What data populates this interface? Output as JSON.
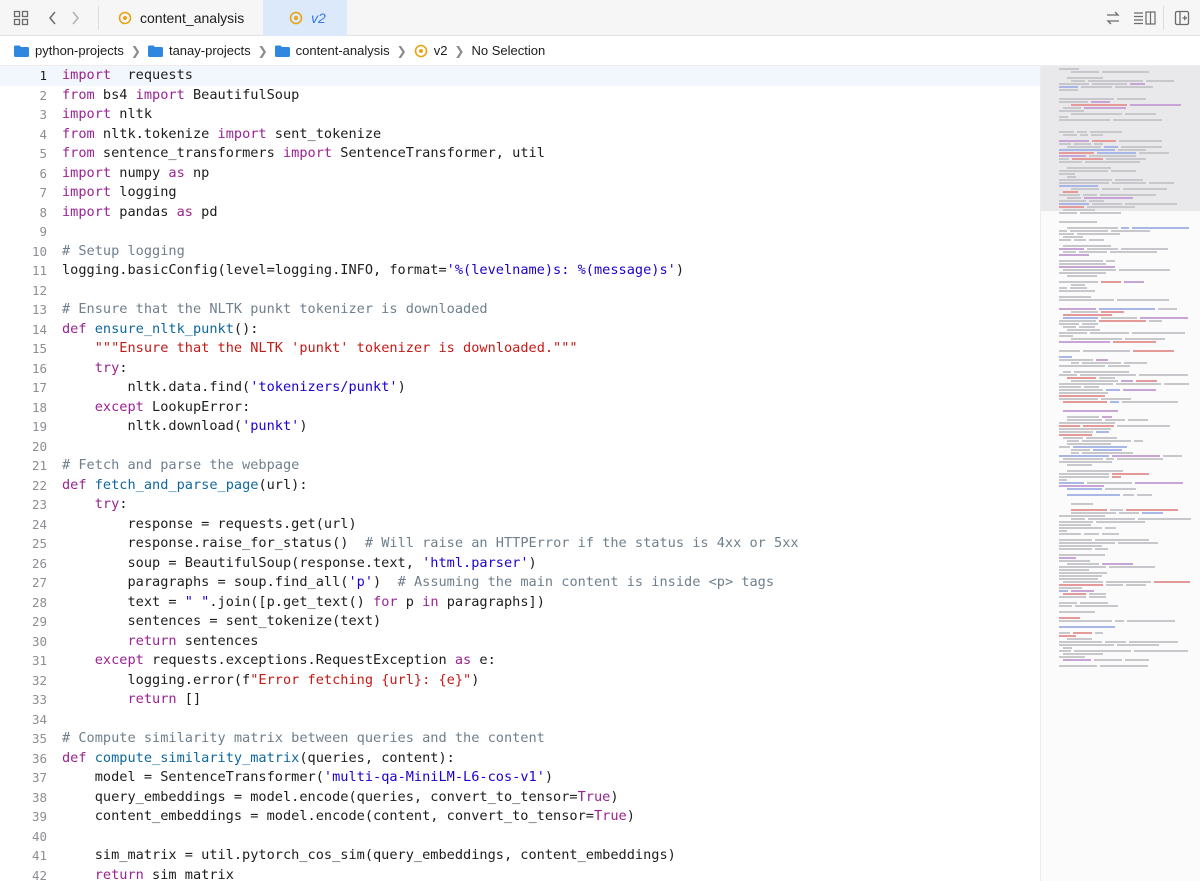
{
  "tabs": [
    {
      "label": "content_analysis",
      "active": false
    },
    {
      "label": "v2",
      "active": true
    }
  ],
  "breadcrumb": [
    {
      "label": "python-projects",
      "icon": "folder-icon"
    },
    {
      "label": "tanay-projects",
      "icon": "folder-icon"
    },
    {
      "label": "content-analysis",
      "icon": "folder-icon"
    },
    {
      "label": "v2",
      "icon": "python-file-icon"
    },
    {
      "label": "No Selection",
      "icon": ""
    }
  ],
  "editor": {
    "current_line": 1,
    "lines": [
      {
        "n": "1",
        "t": [
          [
            "k",
            "import"
          ],
          [
            "",
            "  requests"
          ]
        ]
      },
      {
        "n": "2",
        "t": [
          [
            "k",
            "from"
          ],
          [
            "",
            " bs4 "
          ],
          [
            "k",
            "import"
          ],
          [
            "",
            " BeautifulSoup"
          ]
        ]
      },
      {
        "n": "3",
        "t": [
          [
            "k",
            "import"
          ],
          [
            "",
            " nltk"
          ]
        ]
      },
      {
        "n": "4",
        "t": [
          [
            "k",
            "from"
          ],
          [
            "",
            " nltk.tokenize "
          ],
          [
            "k",
            "import"
          ],
          [
            "",
            " sent_tokenize"
          ]
        ]
      },
      {
        "n": "5",
        "t": [
          [
            "k",
            "from"
          ],
          [
            "",
            " sentence_transformers "
          ],
          [
            "k",
            "import"
          ],
          [
            "",
            " SentenceTransformer, util"
          ]
        ]
      },
      {
        "n": "6",
        "t": [
          [
            "k",
            "import"
          ],
          [
            "",
            " numpy "
          ],
          [
            "k",
            "as"
          ],
          [
            "",
            " np"
          ]
        ]
      },
      {
        "n": "7",
        "t": [
          [
            "k",
            "import"
          ],
          [
            "",
            " logging"
          ]
        ]
      },
      {
        "n": "8",
        "t": [
          [
            "k",
            "import"
          ],
          [
            "",
            " pandas "
          ],
          [
            "k",
            "as"
          ],
          [
            "",
            " pd"
          ]
        ]
      },
      {
        "n": "9",
        "t": []
      },
      {
        "n": "10",
        "t": [
          [
            "c",
            "# Setup logging"
          ]
        ]
      },
      {
        "n": "11",
        "t": [
          [
            "",
            "logging.basicConfig(level=logging.INFO, format="
          ],
          [
            "s",
            "'%(levelname)s: %(message)s'"
          ],
          [
            "",
            ")"
          ]
        ]
      },
      {
        "n": "12",
        "t": []
      },
      {
        "n": "13",
        "t": [
          [
            "c",
            "# Ensure that the NLTK punkt tokenizer is downloaded"
          ]
        ]
      },
      {
        "n": "14",
        "t": [
          [
            "k",
            "def"
          ],
          [
            "",
            " "
          ],
          [
            "f",
            "ensure_nltk_punkt"
          ],
          [
            "",
            "():"
          ]
        ]
      },
      {
        "n": "15",
        "t": [
          [
            "",
            "    "
          ],
          [
            "ds",
            "\"\"\"Ensure that the NLTK 'punkt' tokenizer is downloaded.\"\"\""
          ]
        ]
      },
      {
        "n": "16",
        "t": [
          [
            "",
            "    "
          ],
          [
            "k",
            "try"
          ],
          [
            "",
            ":"
          ]
        ]
      },
      {
        "n": "17",
        "t": [
          [
            "",
            "        nltk.data.find("
          ],
          [
            "s",
            "'tokenizers/punkt'"
          ],
          [
            "",
            ")"
          ]
        ]
      },
      {
        "n": "18",
        "t": [
          [
            "",
            "    "
          ],
          [
            "k",
            "except"
          ],
          [
            "",
            " LookupError:"
          ]
        ]
      },
      {
        "n": "19",
        "t": [
          [
            "",
            "        nltk.download("
          ],
          [
            "s",
            "'punkt'"
          ],
          [
            "",
            ")"
          ]
        ]
      },
      {
        "n": "20",
        "t": []
      },
      {
        "n": "21",
        "t": [
          [
            "c",
            "# Fetch and parse the webpage"
          ]
        ]
      },
      {
        "n": "22",
        "t": [
          [
            "k",
            "def"
          ],
          [
            "",
            " "
          ],
          [
            "f",
            "fetch_and_parse_page"
          ],
          [
            "",
            "(url):"
          ]
        ]
      },
      {
        "n": "23",
        "t": [
          [
            "",
            "    "
          ],
          [
            "k",
            "try"
          ],
          [
            "",
            ":"
          ]
        ]
      },
      {
        "n": "24",
        "t": [
          [
            "",
            "        response = requests.get(url)"
          ]
        ]
      },
      {
        "n": "25",
        "t": [
          [
            "",
            "        response.raise_for_status()  "
          ],
          [
            "c",
            "# Will raise an HTTPError if the status is 4xx or 5xx"
          ]
        ]
      },
      {
        "n": "26",
        "t": [
          [
            "",
            "        soup = BeautifulSoup(response.text, "
          ],
          [
            "s",
            "'html.parser'"
          ],
          [
            "",
            ")"
          ]
        ]
      },
      {
        "n": "27",
        "t": [
          [
            "",
            "        paragraphs = soup.find_all("
          ],
          [
            "s",
            "'p'"
          ],
          [
            "",
            ")  "
          ],
          [
            "c",
            "# Assuming the main content is inside <p> tags"
          ]
        ]
      },
      {
        "n": "28",
        "t": [
          [
            "",
            "        text = "
          ],
          [
            "s",
            "\" \""
          ],
          [
            "",
            ".join([p.get_text() "
          ],
          [
            "k",
            "for"
          ],
          [
            "",
            " p "
          ],
          [
            "k",
            "in"
          ],
          [
            "",
            " paragraphs])"
          ]
        ]
      },
      {
        "n": "29",
        "t": [
          [
            "",
            "        sentences = sent_tokenize(text)"
          ]
        ]
      },
      {
        "n": "30",
        "t": [
          [
            "",
            "        "
          ],
          [
            "k",
            "return"
          ],
          [
            "",
            " sentences"
          ]
        ]
      },
      {
        "n": "31",
        "t": [
          [
            "",
            "    "
          ],
          [
            "k",
            "except"
          ],
          [
            "",
            " requests.exceptions.RequestException "
          ],
          [
            "k",
            "as"
          ],
          [
            "",
            " e:"
          ]
        ]
      },
      {
        "n": "32",
        "t": [
          [
            "",
            "        logging.error(f"
          ],
          [
            "ds",
            "\"Error fetching {url}: {e}\""
          ],
          [
            "",
            ")"
          ]
        ]
      },
      {
        "n": "33",
        "t": [
          [
            "",
            "        "
          ],
          [
            "k",
            "return"
          ],
          [
            "",
            " []"
          ]
        ]
      },
      {
        "n": "34",
        "t": []
      },
      {
        "n": "35",
        "t": [
          [
            "c",
            "# Compute similarity matrix between queries and the content"
          ]
        ]
      },
      {
        "n": "36",
        "t": [
          [
            "k",
            "def"
          ],
          [
            "",
            " "
          ],
          [
            "f",
            "compute_similarity_matrix"
          ],
          [
            "",
            "(queries, content):"
          ]
        ]
      },
      {
        "n": "37",
        "t": [
          [
            "",
            "    model = SentenceTransformer("
          ],
          [
            "s",
            "'multi-qa-MiniLM-L6-cos-v1'"
          ],
          [
            "",
            ")"
          ]
        ]
      },
      {
        "n": "38",
        "t": [
          [
            "",
            "    query_embeddings = model.encode(queries, convert_to_tensor="
          ],
          [
            "k",
            "True"
          ],
          [
            "",
            ")"
          ]
        ]
      },
      {
        "n": "39",
        "t": [
          [
            "",
            "    content_embeddings = model.encode(content, convert_to_tensor="
          ],
          [
            "k",
            "True"
          ],
          [
            "",
            ")"
          ]
        ]
      },
      {
        "n": "40",
        "t": []
      },
      {
        "n": "41",
        "t": [
          [
            "",
            "    sim_matrix = util.pytorch_cos_sim(query_embeddings, content_embeddings)"
          ]
        ]
      },
      {
        "n": "42",
        "t": [
          [
            "",
            "    "
          ],
          [
            "k",
            "return"
          ],
          [
            "",
            " sim_matrix"
          ]
        ]
      }
    ]
  }
}
